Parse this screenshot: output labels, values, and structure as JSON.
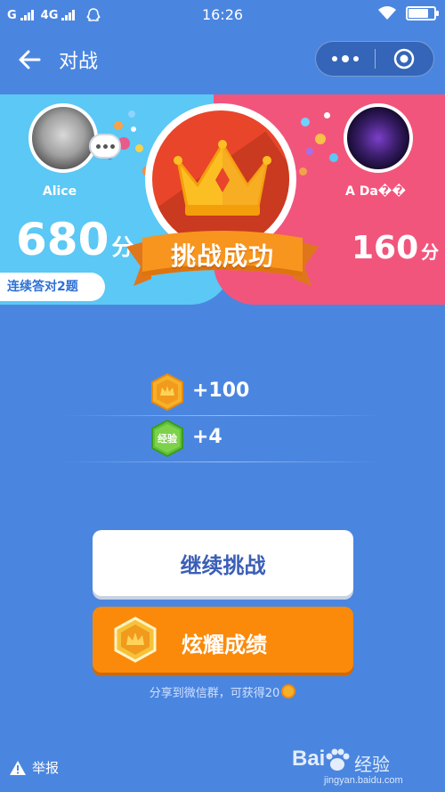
{
  "status_bar": {
    "carrier_left": "G",
    "network": "4G",
    "time": "16:26",
    "battery_level": 0.8
  },
  "nav": {
    "title": "对战"
  },
  "battle": {
    "player_left": {
      "name": "Alice",
      "score": "680",
      "unit": "分",
      "streak": "连续答对2题"
    },
    "player_right": {
      "name": "A Da��",
      "score": "160",
      "unit": "分"
    },
    "result": "挑战成功"
  },
  "rewards": {
    "coins": "+100",
    "exp_label": "经验",
    "exp": "+4"
  },
  "buttons": {
    "continue": "继续挑战",
    "show_off": "炫耀成绩"
  },
  "share_tip": "分享到微信群，可获得20",
  "footer": {
    "report": "举报",
    "watermark_main": "Bai",
    "watermark_cn": "经验",
    "watermark_sub": "jingyan.baidu.com"
  },
  "colors": {
    "background": "#4a86e0",
    "left_panel": "#5bc8f5",
    "right_panel": "#f2557c",
    "medal_red": "#e9452a",
    "orange_button": "#fb8a0a",
    "crown_gold": "#fbbf24"
  }
}
